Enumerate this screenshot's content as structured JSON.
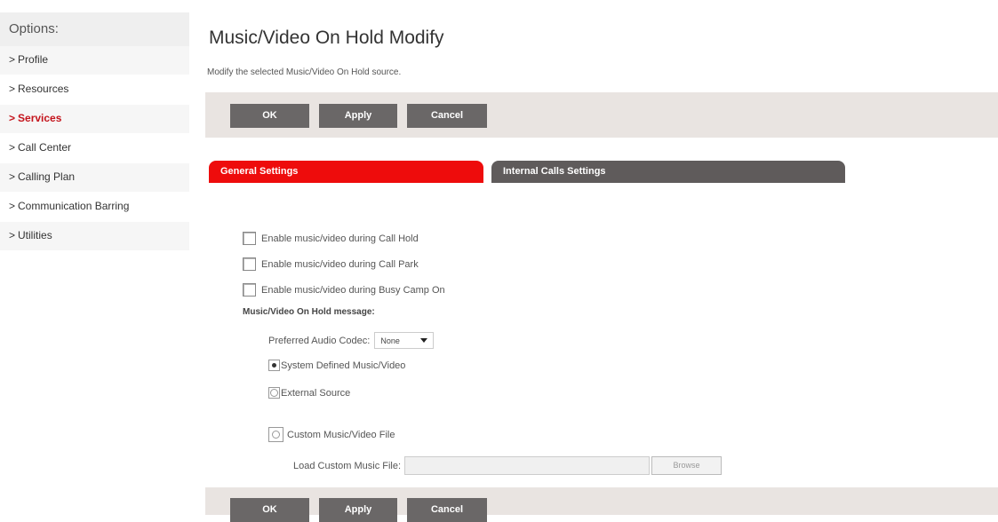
{
  "sidebar": {
    "heading": "Options:",
    "items": [
      {
        "label": "Profile"
      },
      {
        "label": "Resources"
      },
      {
        "label": "Services"
      },
      {
        "label": "Call Center"
      },
      {
        "label": "Calling Plan"
      },
      {
        "label": "Communication Barring"
      },
      {
        "label": "Utilities"
      }
    ],
    "arrow": ">"
  },
  "page": {
    "title": "Music/Video On Hold Modify",
    "subtitle": "Modify the selected Music/Video On Hold source."
  },
  "toolbar": {
    "ok": "OK",
    "apply": "Apply",
    "cancel": "Cancel"
  },
  "tabs": {
    "general": "General Settings",
    "internal": "Internal Calls Settings"
  },
  "form": {
    "chk_call_hold": "Enable music/video during Call Hold",
    "chk_call_park": "Enable music/video during Call Park",
    "chk_busy_camp": "Enable music/video during Busy Camp On",
    "message_heading": "Music/Video On Hold message:",
    "codec_label": "Preferred Audio Codec:",
    "codec_value": "None",
    "radio_system": "System Defined Music/Video",
    "radio_external": "External Source",
    "radio_custom": "Custom Music/Video File",
    "load_label": "Load Custom Music File:",
    "browse": "Browse"
  },
  "colors": {
    "accent_red": "#ee0c0c",
    "services_red": "#c4141c",
    "button_gray": "#6a6767"
  }
}
